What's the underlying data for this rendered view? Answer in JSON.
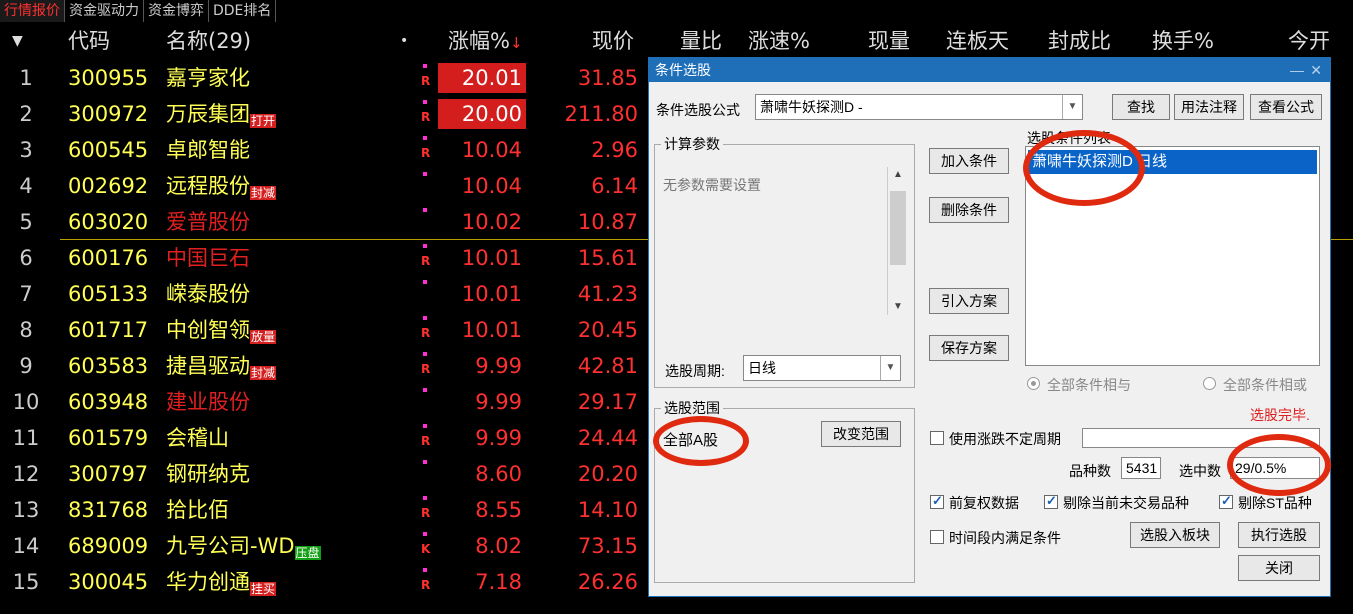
{
  "tabs": [
    "行情报价",
    "资金驱动力",
    "资金博弈",
    "DDE排名"
  ],
  "columns": {
    "sort_icon": "▼",
    "code": "代码",
    "name": "名称(29)",
    "dot": "•",
    "change_pct": "涨幅%",
    "change_sort_arrow": "↓",
    "price": "现价",
    "vol_ratio": "量比",
    "speed": "涨速%",
    "volume": "现量",
    "limit_days": "连板天",
    "seal_ratio": "封成比",
    "turnover": "换手%",
    "open": "今开"
  },
  "rows": [
    {
      "idx": "1",
      "code": "300955",
      "name": "嘉亨家化",
      "name_red": false,
      "badge": "",
      "flag": "R",
      "change": "20.01",
      "price": "31.85",
      "highlight": true
    },
    {
      "idx": "2",
      "code": "300972",
      "name": "万辰集团",
      "name_red": false,
      "badge": "打开",
      "flag": "R",
      "change": "20.00",
      "price": "211.80",
      "highlight": true
    },
    {
      "idx": "3",
      "code": "600545",
      "name": "卓郎智能",
      "name_red": false,
      "badge": "",
      "flag": "R",
      "change": "10.04",
      "price": "2.96",
      "highlight": false
    },
    {
      "idx": "4",
      "code": "002692",
      "name": "远程股份",
      "name_red": false,
      "badge": "封减",
      "flag": "",
      "change": "10.04",
      "price": "6.14",
      "highlight": false
    },
    {
      "idx": "5",
      "code": "603020",
      "name": "爱普股份",
      "name_red": true,
      "badge": "",
      "flag": "",
      "change": "10.02",
      "price": "10.87",
      "highlight": false
    },
    {
      "idx": "6",
      "code": "600176",
      "name": "中国巨石",
      "name_red": true,
      "badge": "",
      "flag": "R",
      "change": "10.01",
      "price": "15.61",
      "highlight": false
    },
    {
      "idx": "7",
      "code": "605133",
      "name": "嵘泰股份",
      "name_red": false,
      "badge": "",
      "flag": "",
      "change": "10.01",
      "price": "41.23",
      "highlight": false
    },
    {
      "idx": "8",
      "code": "601717",
      "name": "中创智领",
      "name_red": false,
      "badge": "放量",
      "flag": "R",
      "change": "10.01",
      "price": "20.45",
      "highlight": false
    },
    {
      "idx": "9",
      "code": "603583",
      "name": "捷昌驱动",
      "name_red": false,
      "badge": "封减",
      "flag": "R",
      "change": "9.99",
      "price": "42.81",
      "highlight": false
    },
    {
      "idx": "10",
      "code": "603948",
      "name": "建业股份",
      "name_red": true,
      "badge": "",
      "flag": "",
      "change": "9.99",
      "price": "29.17",
      "highlight": false
    },
    {
      "idx": "11",
      "code": "601579",
      "name": "会稽山",
      "name_red": false,
      "badge": "",
      "flag": "R",
      "change": "9.99",
      "price": "24.44",
      "highlight": false
    },
    {
      "idx": "12",
      "code": "300797",
      "name": "钢研纳克",
      "name_red": false,
      "badge": "",
      "flag": "",
      "change": "8.60",
      "price": "20.20",
      "highlight": false
    },
    {
      "idx": "13",
      "code": "831768",
      "name": "拾比佰",
      "name_red": false,
      "badge": "",
      "flag": "R",
      "change": "8.55",
      "price": "14.10",
      "highlight": false
    },
    {
      "idx": "14",
      "code": "689009",
      "name": "九号公司-WD",
      "name_red": false,
      "badge": "压盘",
      "badge_green": true,
      "flag": "K",
      "change": "8.02",
      "price": "73.15",
      "highlight": false
    },
    {
      "idx": "15",
      "code": "300045",
      "name": "华力创通",
      "name_red": false,
      "badge": "挂买",
      "flag": "R",
      "change": "7.18",
      "price": "26.26",
      "highlight": false
    }
  ],
  "dialog": {
    "title": "条件选股",
    "min_icon": "—",
    "close_icon": "✕",
    "formula_label": "条件选股公式",
    "formula_value": "萧啸牛妖探测D  -",
    "find_btn": "查找",
    "usage_btn": "用法注释",
    "view_btn": "查看公式",
    "params_legend": "计算参数",
    "params_text": "无参数需要设置",
    "add_btn": "加入条件",
    "delete_btn": "删除条件",
    "import_btn": "引入方案",
    "save_btn": "保存方案",
    "list_legend": "选股条件列表",
    "list_item": "萧啸牛妖探测D  日线",
    "radio_and": "全部条件相与",
    "radio_or": "全部条件相或",
    "status": "选股完毕.",
    "period_label": "选股周期:",
    "period_value": "日线",
    "range_legend": "选股范围",
    "range_value": "全部A股",
    "change_range_btn": "改变范围",
    "use_period_label": "使用涨跌不定周期",
    "count_label": "品种数",
    "count_value": "5431",
    "selected_label": "选中数",
    "selected_value": "29/0.5%",
    "chk_adjust": "前复权数据",
    "chk_exclude_untraded": "剔除当前未交易品种",
    "chk_exclude_st": "剔除ST品种",
    "chk_timeframe": "时间段内满足条件",
    "to_block_btn": "选股入板块",
    "execute_btn": "执行选股",
    "close_btn": "关闭"
  },
  "colors": {
    "up": "#ff3030",
    "code": "#ffff55",
    "dialog_title": "#1e6fb8",
    "annotation": "#e02a10"
  }
}
